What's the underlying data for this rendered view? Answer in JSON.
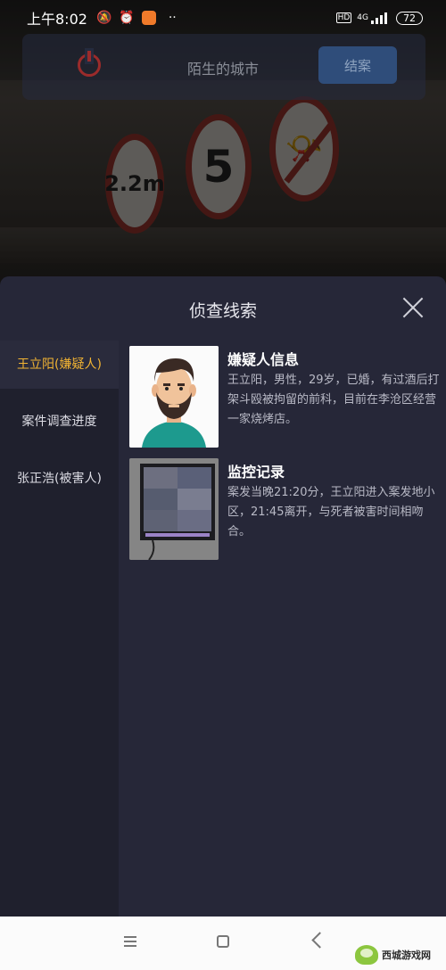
{
  "status_bar": {
    "time": "上午8:02",
    "icons": [
      "mute-icon",
      "alarm-icon",
      "app-badge-icon",
      "more-dots-icon"
    ],
    "dots": "··",
    "hd_label": "HD",
    "network_label": "4G",
    "battery": "72"
  },
  "top_bar": {
    "title": "陌生的城市",
    "close_case_label": "结案",
    "power_icon": "power-icon"
  },
  "scene": {
    "signs": [
      "2.2m",
      "5",
      "horn-prohibited"
    ]
  },
  "panel": {
    "title": "侦查线索",
    "close_icon": "close-icon",
    "sidebar": {
      "items": [
        {
          "label": "王立阳(嫌疑人)",
          "active": true
        },
        {
          "label": "案件调查进度",
          "active": false
        },
        {
          "label": "张正浩(被害人)",
          "active": false
        }
      ]
    },
    "clues": [
      {
        "title": "嫌疑人信息",
        "description": "王立阳，男性，29岁，已婚，有过酒后打架斗殴被拘留的前科，目前在李沧区经营一家烧烤店。",
        "thumbnail": "suspect-portrait"
      },
      {
        "title": "监控记录",
        "description": "案发当晚21:20分，王立阳进入案发地小区，21:45离开，与死者被害时间相吻合。",
        "thumbnail": "surveillance-monitor"
      }
    ]
  },
  "nav_bar": {
    "icons": [
      "menu-icon",
      "home-icon",
      "back-icon"
    ]
  },
  "watermark": {
    "text": "西城游戏网"
  },
  "colors": {
    "accent_active": "#f2b433",
    "panel_bg": "#262738",
    "sidebar_bg": "#1f202d",
    "button_bg": "#2f4d7a"
  }
}
